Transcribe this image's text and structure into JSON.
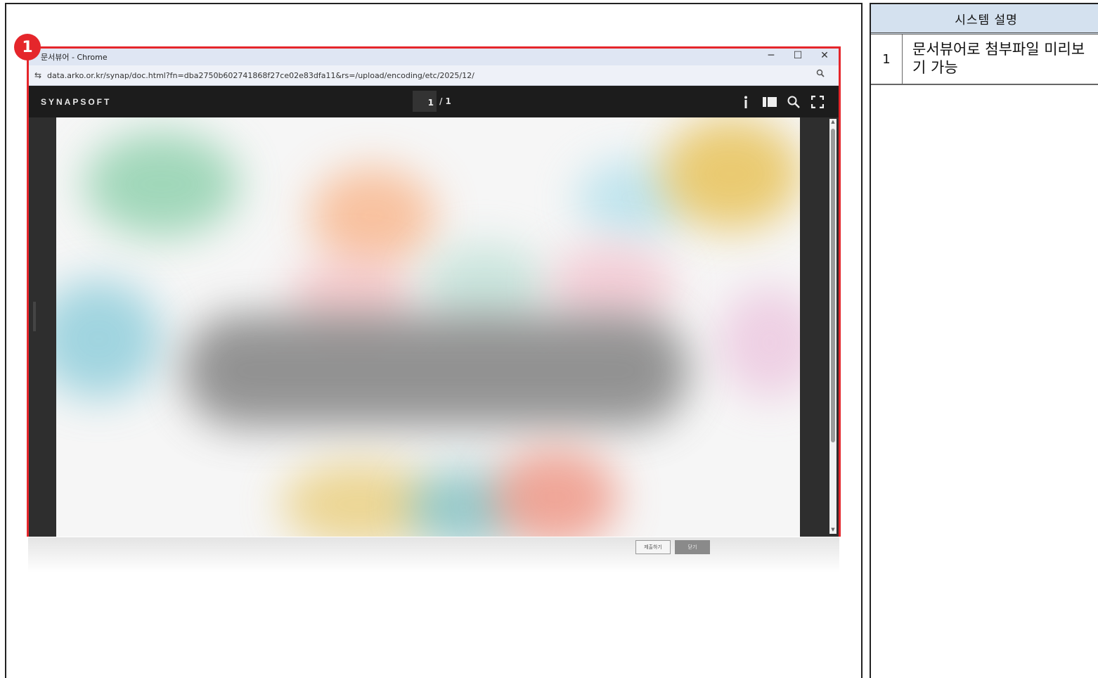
{
  "marker": {
    "number": "1"
  },
  "window": {
    "title": "문서뷰어 - Chrome",
    "controls": {
      "minimize": "─",
      "maximize": "☐",
      "close": "✕"
    },
    "address": "data.arko.or.kr/synap/doc.html?fn=dba2750b602741868f27ce02e83dfa11&rs=/upload/encoding/etc/2025/12/"
  },
  "viewer": {
    "brand": "SYNAPSOFT",
    "current_page": "1",
    "total_pages": "/ 1",
    "tools": [
      "info-icon",
      "sidebar-icon",
      "search-icon",
      "fullscreen-icon"
    ]
  },
  "page_buttons": {
    "secondary": "제출하기",
    "primary": "닫기"
  },
  "description_table": {
    "header": "시스템 설명",
    "rows": [
      {
        "num": "1",
        "desc": "문서뷰어로 첨부파일 미리보기 가능"
      }
    ]
  },
  "colors": {
    "highlight": "#e5262b",
    "table_header": "#d4e1ef",
    "viewer_bar": "#1c1c1c"
  }
}
